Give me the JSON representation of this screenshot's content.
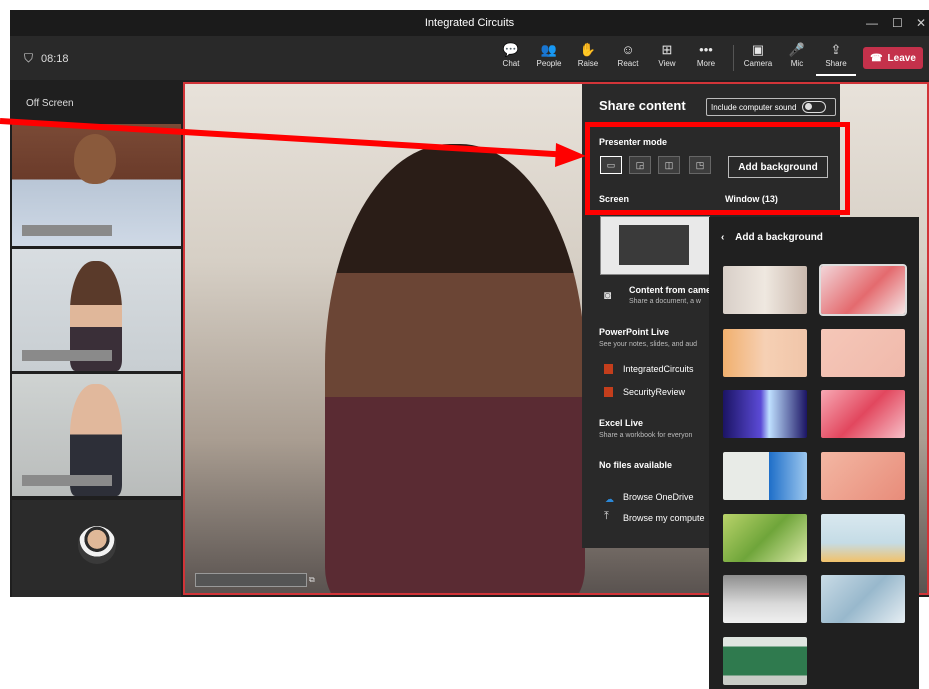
{
  "window": {
    "title": "Integrated Circuits",
    "min": "—",
    "max": "☐",
    "close": "✕"
  },
  "toolbar": {
    "timer": "08:18",
    "items": [
      {
        "label": "Chat",
        "icon": "chat-icon",
        "glyph": "💬"
      },
      {
        "label": "People",
        "icon": "people-icon",
        "glyph": "👥"
      },
      {
        "label": "Raise",
        "icon": "raise-hand-icon",
        "glyph": "✋"
      },
      {
        "label": "React",
        "icon": "react-icon",
        "glyph": "☺"
      },
      {
        "label": "View",
        "icon": "view-grid-icon",
        "glyph": "⊞"
      },
      {
        "label": "More",
        "icon": "more-icon",
        "glyph": "•••"
      },
      {
        "label": "Camera",
        "icon": "camera-off-icon",
        "glyph": "▣"
      },
      {
        "label": "Mic",
        "icon": "mic-off-icon",
        "glyph": "🎤"
      },
      {
        "label": "Share",
        "icon": "share-icon",
        "glyph": "⇪"
      }
    ],
    "leave": "Leave"
  },
  "sidebar": {
    "off_screen": "Off Screen"
  },
  "share": {
    "title": "Share content",
    "include_sound": "Include computer sound",
    "presenter_mode": "Presenter mode",
    "add_background": "Add background",
    "screen": "Screen",
    "window": "Window (13)",
    "content_camera": "Content from came",
    "content_camera_sub": "Share a document, a w",
    "ppt_live": "PowerPoint Live",
    "ppt_sub": "See your notes, slides, and aud",
    "file1": "IntegratedCircuits",
    "file2": "SecurityReview",
    "excel_live": "Excel Live",
    "excel_sub": "Share a workbook for everyon",
    "no_files": "No files available",
    "browse_onedrive": "Browse OneDrive",
    "browse_computer": "Browse my compute"
  },
  "flyout": {
    "title": "Add a background",
    "back": "‹"
  },
  "colors": {
    "accent_red": "#ff0000",
    "leave": "#c4314b",
    "panel": "#292929"
  }
}
